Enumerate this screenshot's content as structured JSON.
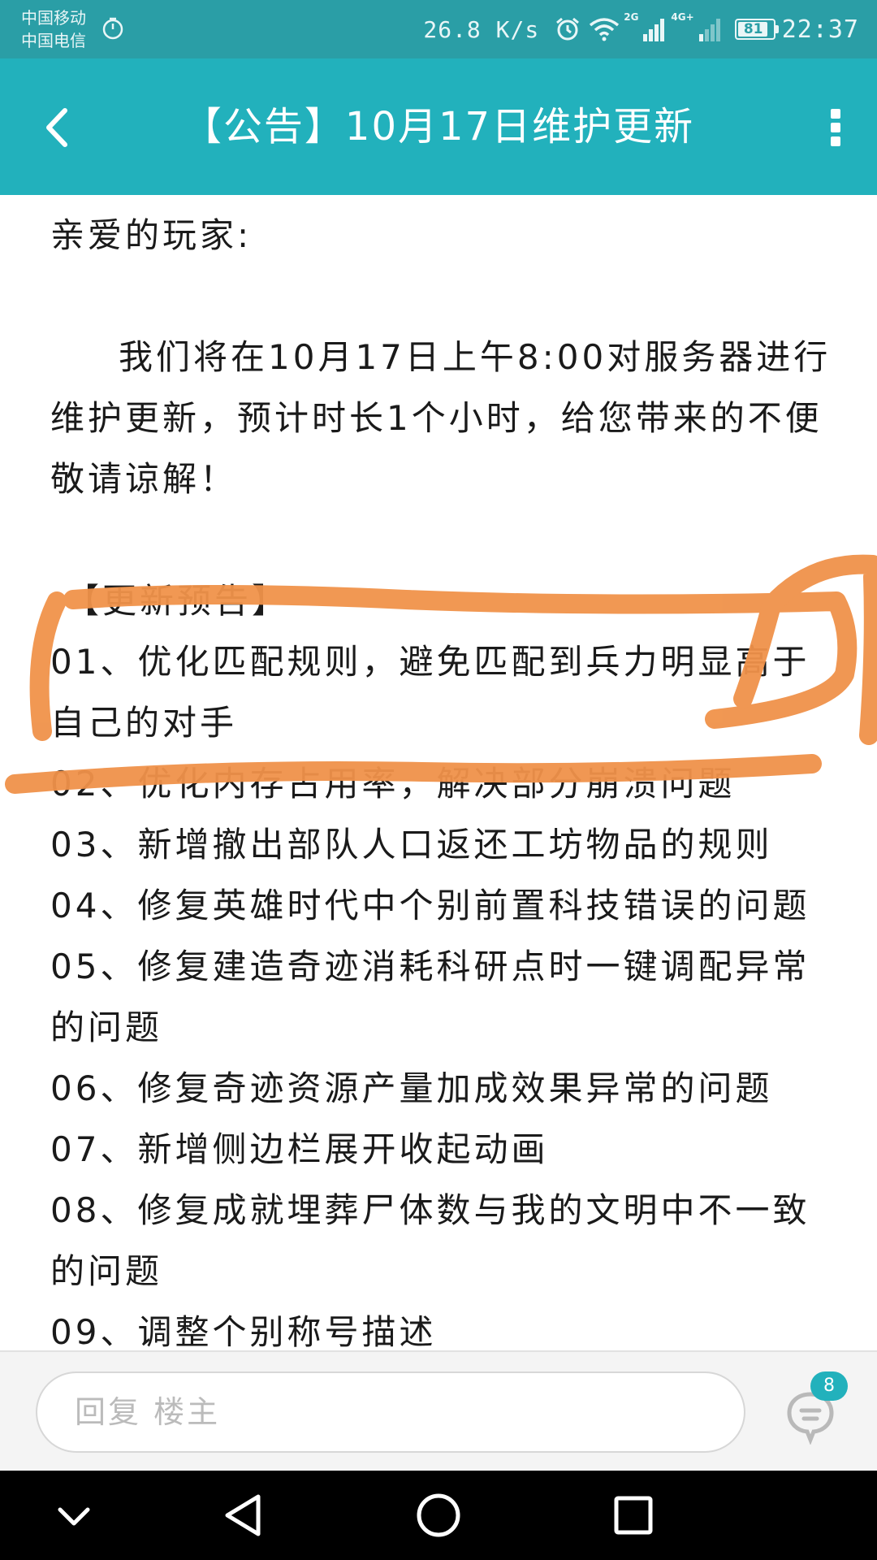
{
  "status_bar": {
    "carrier_1": "中国移动",
    "carrier_2": "中国电信",
    "network_speed": "26.8 K/s",
    "network_2g": "2G",
    "network_4g": "4G+",
    "battery": "81",
    "time": "22:37",
    "icons": [
      "timer-icon",
      "alarm-icon",
      "wifi-icon",
      "signal-icon",
      "battery-icon"
    ]
  },
  "app_bar": {
    "title": "【公告】10月17日维护更新",
    "back_icon": "chevron-left-icon",
    "more_icon": "more-vertical-icon",
    "color": "#22b1bc"
  },
  "post": {
    "greeting": "亲爱的玩家:",
    "paragraph": "我们将在10月17日上午8:00对服务器进行维护更新，预计时长1个小时，给您带来的不便敬请谅解！",
    "section_title": "【更新预告】",
    "items": [
      "01、优化匹配规则，避免匹配到兵力明显高于自己的对手",
      "02、优化内存占用率，解决部分崩溃问题",
      "03、新增撤出部队人口返还工坊物品的规则",
      "04、修复英雄时代中个别前置科技错误的问题",
      "05、修复建造奇迹消耗科研点时一键调配异常的问题",
      "06、修复奇迹资源产量加成效果异常的问题",
      "07、新增侧边栏展开收起动画",
      "08、修复成就埋葬尸体数与我的文明中不一致的问题",
      "09、调整个别称号描述"
    ]
  },
  "annotation": {
    "color": "#f0924a"
  },
  "reply_bar": {
    "placeholder": "回复  楼主",
    "comment_icon": "comment-icon",
    "comment_count": "8"
  },
  "nav_bar": {
    "icons": [
      "chevron-down-icon",
      "back-triangle-icon",
      "home-circle-icon",
      "recents-square-icon"
    ]
  }
}
